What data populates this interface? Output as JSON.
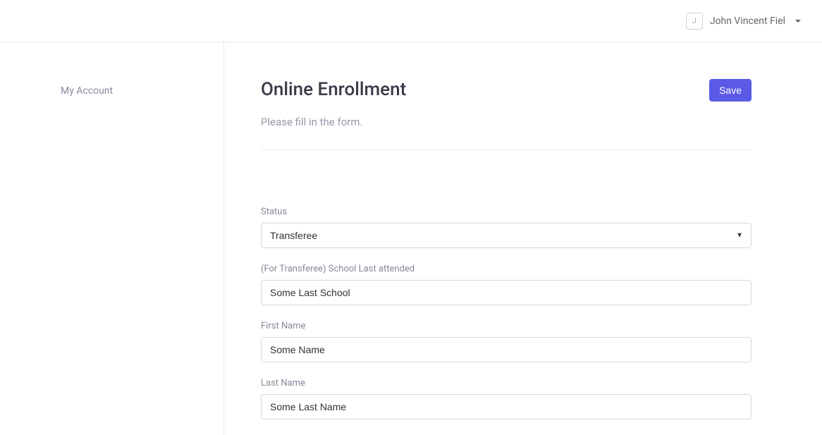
{
  "header": {
    "user_initial": "J",
    "user_name": "John Vincent Fiel"
  },
  "sidebar": {
    "my_account_label": "My Account"
  },
  "main": {
    "title": "Online Enrollment",
    "subtitle": "Please fill in the form.",
    "save_label": "Save"
  },
  "form": {
    "status": {
      "label": "Status",
      "value": "Transferee"
    },
    "school_last": {
      "label": "(For Transferee) School Last attended",
      "value": "Some Last School"
    },
    "first_name": {
      "label": "First Name",
      "value": "Some Name"
    },
    "last_name": {
      "label": "Last Name",
      "value": "Some Last Name"
    }
  }
}
